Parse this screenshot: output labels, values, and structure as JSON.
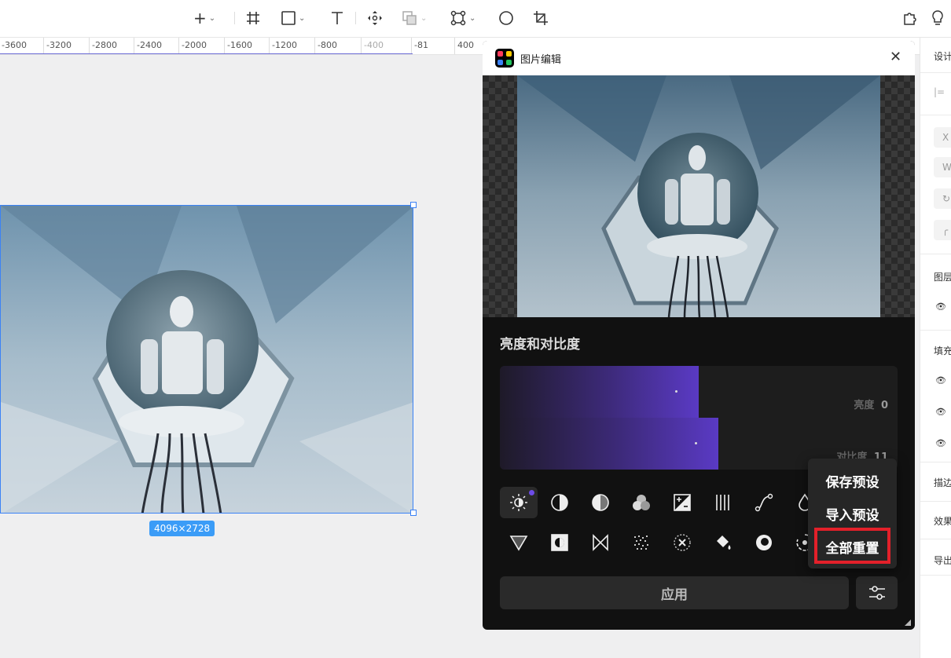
{
  "toolbar": {
    "tools": [
      {
        "name": "add",
        "glyph": "+",
        "has_menu": true
      },
      {
        "name": "frame",
        "glyph": "#"
      },
      {
        "name": "rectangle",
        "glyph": "□",
        "has_menu": true
      },
      {
        "name": "text",
        "glyph": "T"
      },
      {
        "name": "move",
        "glyph": "✥"
      },
      {
        "name": "boolean",
        "glyph": "⧉",
        "has_menu": true
      },
      {
        "name": "component",
        "glyph": "⌘",
        "has_menu": true
      },
      {
        "name": "ellipse",
        "glyph": "○"
      },
      {
        "name": "crop",
        "glyph": "⌗"
      }
    ],
    "plugins_icon": "puzzle-icon",
    "tips_icon": "bulb-icon"
  },
  "ruler": {
    "ticks": [
      "-3600",
      "-3200",
      "-2800",
      "-2400",
      "-2000",
      "-1600",
      "-1200",
      "-800",
      "-400",
      "-81",
      "400"
    ]
  },
  "canvas": {
    "image_size": "4096×2728"
  },
  "right_panel": {
    "tab": "设计",
    "fields": [
      "X",
      "W"
    ],
    "sections": [
      "图层",
      "填充",
      "描边",
      "效果",
      "导出"
    ]
  },
  "dialog": {
    "title": "图片编辑",
    "section_title": "亮度和对比度",
    "sliders": [
      {
        "label": "亮度",
        "value": "0",
        "fill": 0.5
      },
      {
        "label": "对比度",
        "value": "11",
        "fill": 0.55
      }
    ],
    "apply_label": "应用",
    "menu": {
      "save_preset": "保存预设",
      "import_preset": "导入预设",
      "reset_all": "全部重置"
    },
    "accent_color": "#5a3ac4",
    "highlight_color": "#e3202a"
  }
}
